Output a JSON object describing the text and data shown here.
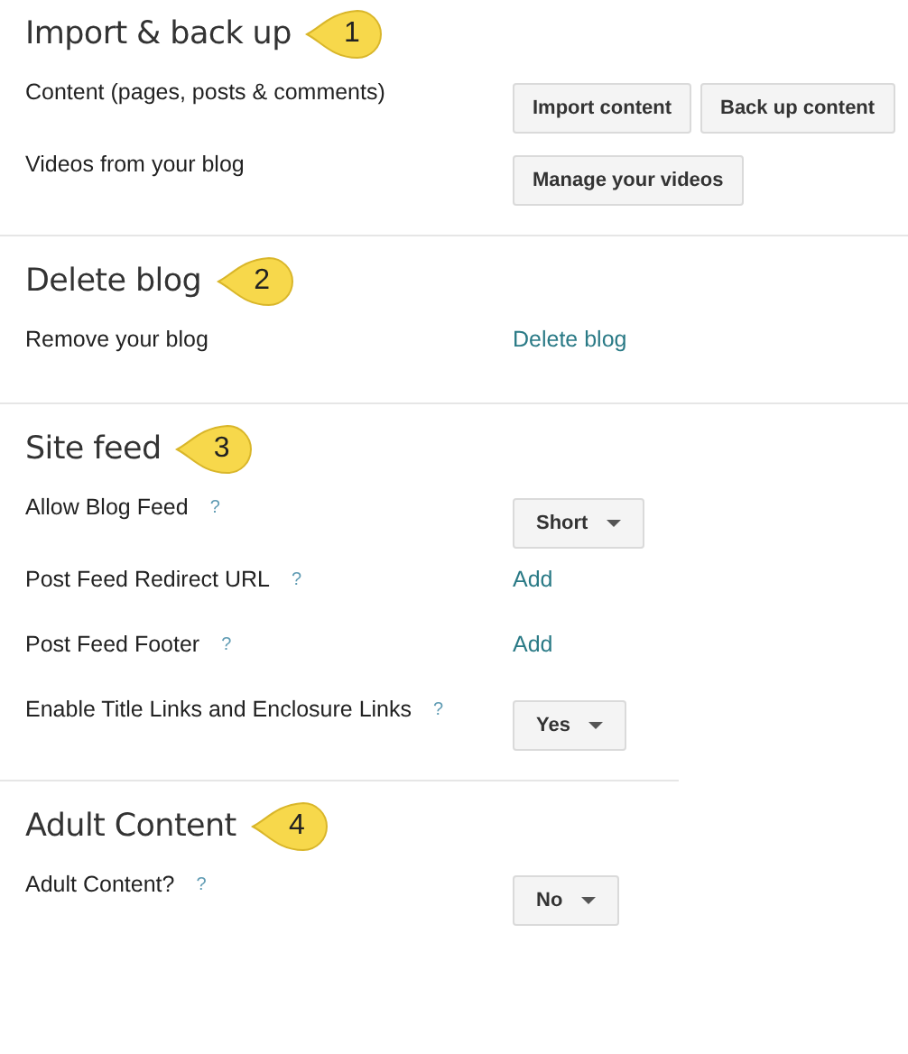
{
  "sections": [
    {
      "title": "Import & back up",
      "callout": "1",
      "rows": [
        {
          "label": "Content (pages, posts & comments)",
          "control": {
            "kind": "buttons",
            "items": [
              "Import content",
              "Back up content"
            ]
          }
        },
        {
          "label": "Videos from your blog",
          "control": {
            "kind": "buttons",
            "items": [
              "Manage your videos"
            ]
          }
        }
      ]
    },
    {
      "title": "Delete blog",
      "callout": "2",
      "rows": [
        {
          "label": "Remove your blog",
          "control": {
            "kind": "link",
            "text": "Delete blog"
          }
        }
      ]
    },
    {
      "title": "Site feed",
      "callout": "3",
      "rows": [
        {
          "label": "Allow Blog Feed",
          "help": "?",
          "control": {
            "kind": "dropdown",
            "value": "Short"
          }
        },
        {
          "label": "Post Feed Redirect URL",
          "help": "?",
          "control": {
            "kind": "link",
            "text": "Add"
          }
        },
        {
          "label": "Post Feed Footer",
          "help": "?",
          "control": {
            "kind": "link",
            "text": "Add"
          }
        },
        {
          "label": "Enable Title Links and Enclosure Links",
          "help": "?",
          "control": {
            "kind": "dropdown",
            "value": "Yes"
          }
        }
      ]
    },
    {
      "title": "Adult Content",
      "callout": "4",
      "rows": [
        {
          "label": "Adult Content?",
          "help": "?",
          "control": {
            "kind": "dropdown",
            "value": "No"
          }
        }
      ]
    }
  ]
}
